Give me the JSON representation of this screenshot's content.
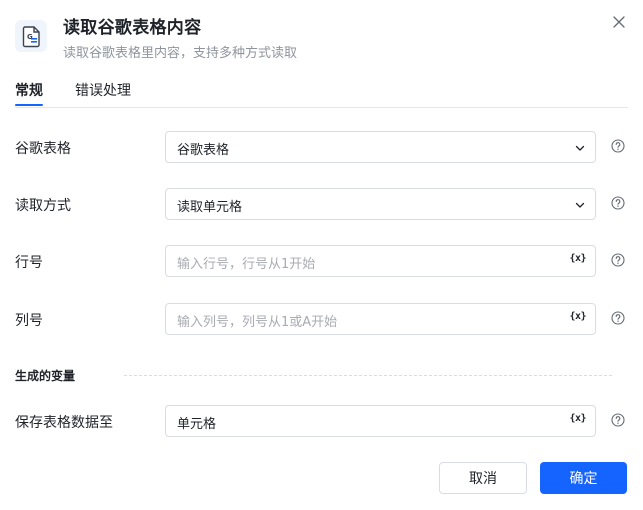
{
  "header": {
    "title": "读取谷歌表格内容",
    "subtitle": "读取谷歌表格里内容，支持多种方式读取",
    "icon": "google-sheets-icon"
  },
  "tabs": [
    {
      "label": "常规",
      "active": true
    },
    {
      "label": "错误处理",
      "active": false
    }
  ],
  "form": {
    "sheet": {
      "label": "谷歌表格",
      "value": "谷歌表格"
    },
    "read_mode": {
      "label": "读取方式",
      "value": "读取单元格"
    },
    "row": {
      "label": "行号",
      "placeholder": "输入行号，行号从1开始",
      "var_badge": "{x}"
    },
    "col": {
      "label": "列号",
      "placeholder": "输入列号，列号从1或A开始",
      "var_badge": "{x}"
    }
  },
  "output": {
    "section_title": "生成的变量",
    "save_to": {
      "label": "保存表格数据至",
      "value": "单元格",
      "var_badge": "{x}"
    }
  },
  "footer": {
    "cancel_label": "取消",
    "confirm_label": "确定"
  },
  "colors": {
    "accent": "#1664ff",
    "border": "#d9dde3",
    "muted": "#8f959e"
  }
}
